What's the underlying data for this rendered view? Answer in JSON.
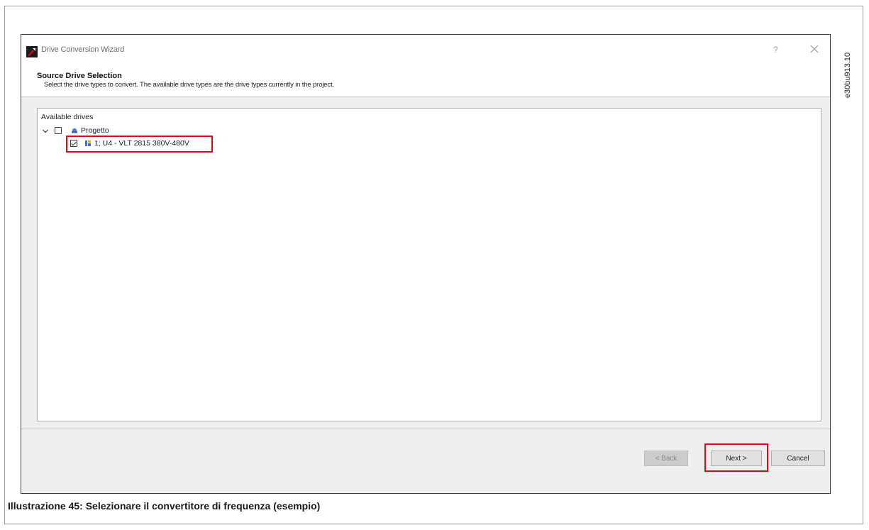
{
  "window": {
    "title": "Drive Conversion Wizard",
    "help_label": "?",
    "close_icon": "close-icon",
    "app_icon": "app-logo-icon"
  },
  "header": {
    "title": "Source Drive Selection",
    "description": "Select the drive types to convert. The available drive types are the drive types currently in the project."
  },
  "drives_panel": {
    "label": "Available drives",
    "tree": [
      {
        "label": "Progetto",
        "checked": false,
        "expanded": true,
        "icon": "project-icon"
      },
      {
        "label": "1; U4 - VLT 2815 380V-480V",
        "checked": true,
        "icon": "drive-icon",
        "highlighted": true
      }
    ]
  },
  "footer": {
    "back_label": "< Back",
    "next_label": "Next >",
    "cancel_label": "Cancel"
  },
  "document": {
    "reference_code": "e30bu913.10",
    "caption": "Illustrazione 45: Selezionare il convertitore di frequenza (esempio)"
  },
  "colors": {
    "highlight": "#e30613",
    "dialog_background": "#efefef"
  }
}
